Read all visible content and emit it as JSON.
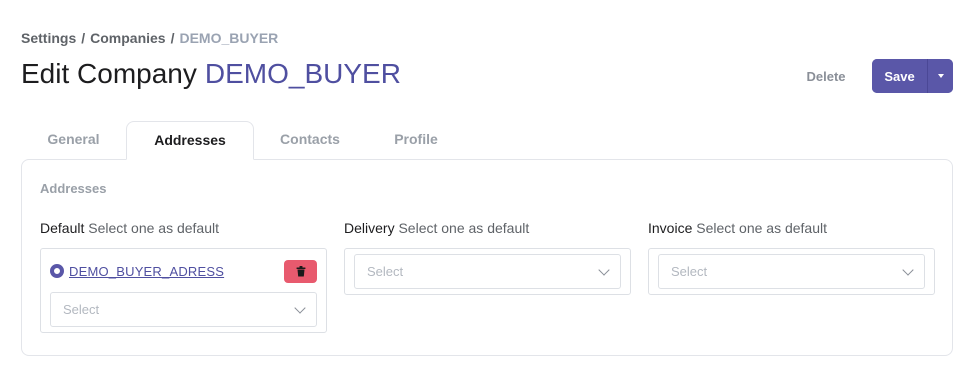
{
  "breadcrumb": {
    "items": [
      "Settings",
      "Companies"
    ],
    "separator": "/",
    "current": "DEMO_BUYER"
  },
  "header": {
    "title_prefix": "Edit Company",
    "title_name": "DEMO_BUYER"
  },
  "actions": {
    "delete_label": "Delete",
    "save_label": "Save"
  },
  "tabs": [
    {
      "label": "General",
      "active": false
    },
    {
      "label": "Addresses",
      "active": true
    },
    {
      "label": "Contacts",
      "active": false
    },
    {
      "label": "Profile",
      "active": false
    }
  ],
  "addresses": {
    "section_title": "Addresses",
    "columns": [
      {
        "label": "Default",
        "hint": "Select one as default",
        "addresses": [
          "DEMO_BUYER_ADRESS"
        ],
        "select_placeholder": "Select"
      },
      {
        "label": "Delivery",
        "hint": "Select one as default",
        "addresses": [],
        "select_placeholder": "Select"
      },
      {
        "label": "Invoice",
        "hint": "Select one as default",
        "addresses": [],
        "select_placeholder": "Select"
      }
    ]
  },
  "colors": {
    "accent": "#5a57a8",
    "title_name": "#4f4fa0",
    "danger": "#e85a6e"
  },
  "icons": {
    "trash": "trash-icon",
    "radio": "radio-selected-icon",
    "chevron": "chevron-down-icon",
    "caret": "caret-down-icon"
  }
}
